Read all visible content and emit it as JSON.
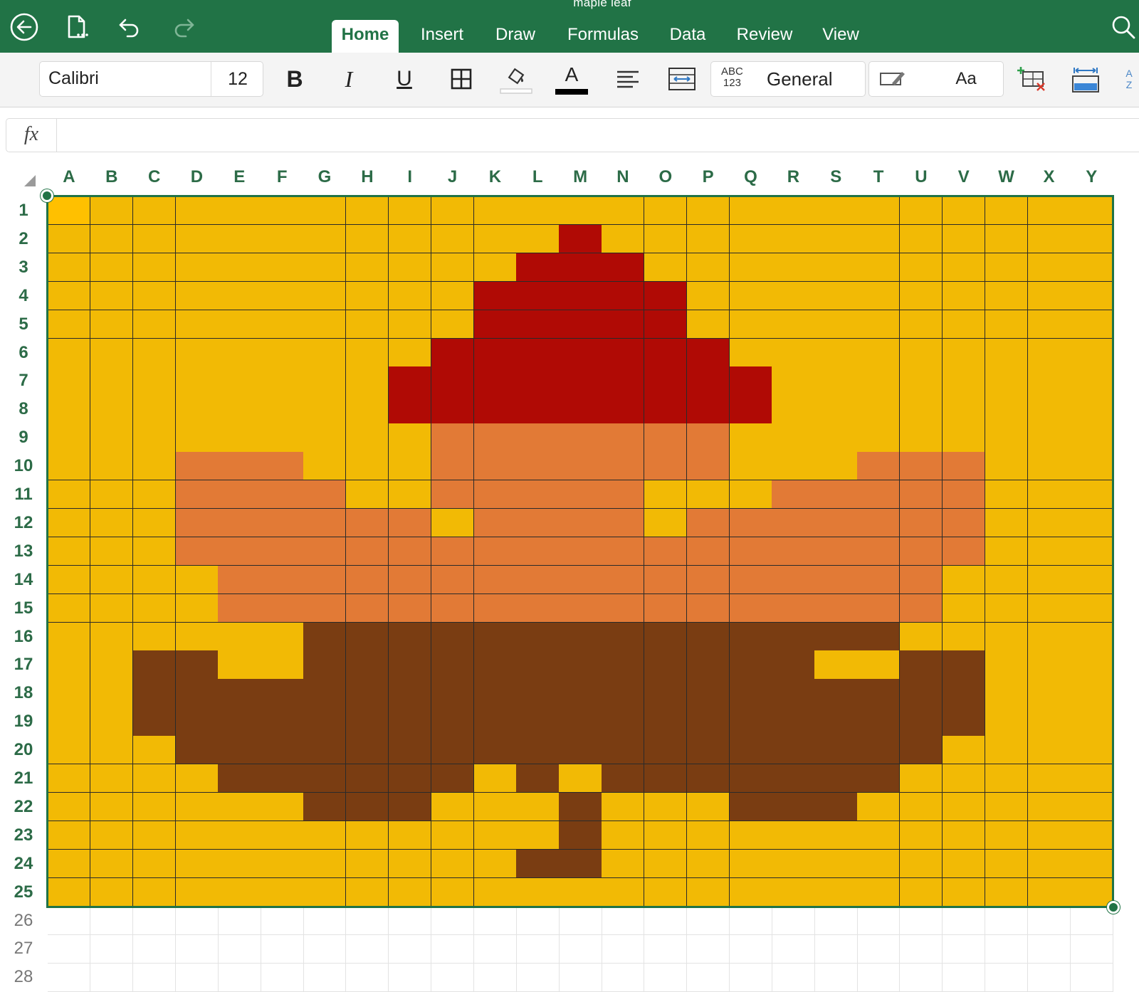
{
  "app": {
    "document_title": "maple leaf"
  },
  "ribbon": {
    "tabs": [
      {
        "label": "Home",
        "active": true
      },
      {
        "label": "Insert",
        "active": false
      },
      {
        "label": "Draw",
        "active": false
      },
      {
        "label": "Formulas",
        "active": false
      },
      {
        "label": "Data",
        "active": false
      },
      {
        "label": "Review",
        "active": false
      },
      {
        "label": "View",
        "active": false
      }
    ],
    "icons": [
      "back-icon",
      "file-icon",
      "undo-icon",
      "redo-icon",
      "search-icon"
    ]
  },
  "toolbar": {
    "font_name": "Calibri",
    "font_size": "12",
    "bold_label": "B",
    "italic_label": "I",
    "underline_label": "U",
    "font_color_label": "A",
    "number_format_icon_top": "ABC",
    "number_format_icon_bottom": "123",
    "number_format": "General",
    "cell_styles_label": "Aa",
    "sort_label_top": "A",
    "sort_label_bottom": "Z",
    "icons": [
      "borders-icon",
      "fill-color-icon",
      "font-color-icon",
      "align-icon",
      "wrap-text-icon",
      "format-painter-icon",
      "insert-delete-icon",
      "freeze-panes-icon",
      "sort-icon"
    ]
  },
  "formula_bar": {
    "fx_label": "fx",
    "value": ""
  },
  "colors": {
    "accent": "#217346",
    "background_cell": "#F2BA05",
    "red": "#B00A05",
    "orange": "#E27A36",
    "brown": "#7A3D12",
    "selected_cell": "#FFC000"
  },
  "sheet": {
    "columns": [
      "A",
      "B",
      "C",
      "D",
      "E",
      "F",
      "G",
      "H",
      "I",
      "J",
      "K",
      "L",
      "M",
      "N",
      "O",
      "P",
      "Q",
      "R",
      "S",
      "T",
      "U",
      "V",
      "W",
      "X",
      "Y"
    ],
    "rows": [
      "1",
      "2",
      "3",
      "4",
      "5",
      "6",
      "7",
      "8",
      "9",
      "10",
      "11",
      "12",
      "13",
      "14",
      "15",
      "16",
      "17",
      "18",
      "19",
      "20",
      "21",
      "22",
      "23",
      "24",
      "25",
      "26",
      "27",
      "28"
    ],
    "active_cell": "A1",
    "selection": "A1:Y25",
    "legend": {
      ".": "background_cell",
      "R": "red",
      "O": "orange",
      "B": "brown"
    },
    "pixel_art": [
      ".........................",
      "............R............",
      "...........RRR...........",
      "..........RRRRR..........",
      "..........RRRRR..........",
      ".........RRRRRRR.........",
      "........RRRRRRRRR........",
      "........RRRRRRRRR........",
      ".........OOOOOOO.........",
      "...OOO...OOOOOOO...OOO...",
      "...OOOO..OOOOO...OOOOO...",
      "...OOOOOO.OOOO.OOOOOOO...",
      "...OOOOOOOOOOOOOOOOOOO...",
      "....OOOOOOOOOOOOOOOOO....",
      "....OOOOOOOOOOOOOOOOO....",
      "......BBBBBBBBBBBBBB.....",
      "..BB..BBBBBBBBBBBB..BB...",
      "..BBBBBBBBBBBBBBBBBBBB...",
      "..BBBBBBBBBBBBBBBBBBBB...",
      "...BBBBBBBBBBBBBBBBBB....",
      "....BBBBBB.B.BBBBBBB.....",
      "......BBB...B...BBB......",
      "............B............",
      "...........BB............",
      "........................."
    ]
  }
}
